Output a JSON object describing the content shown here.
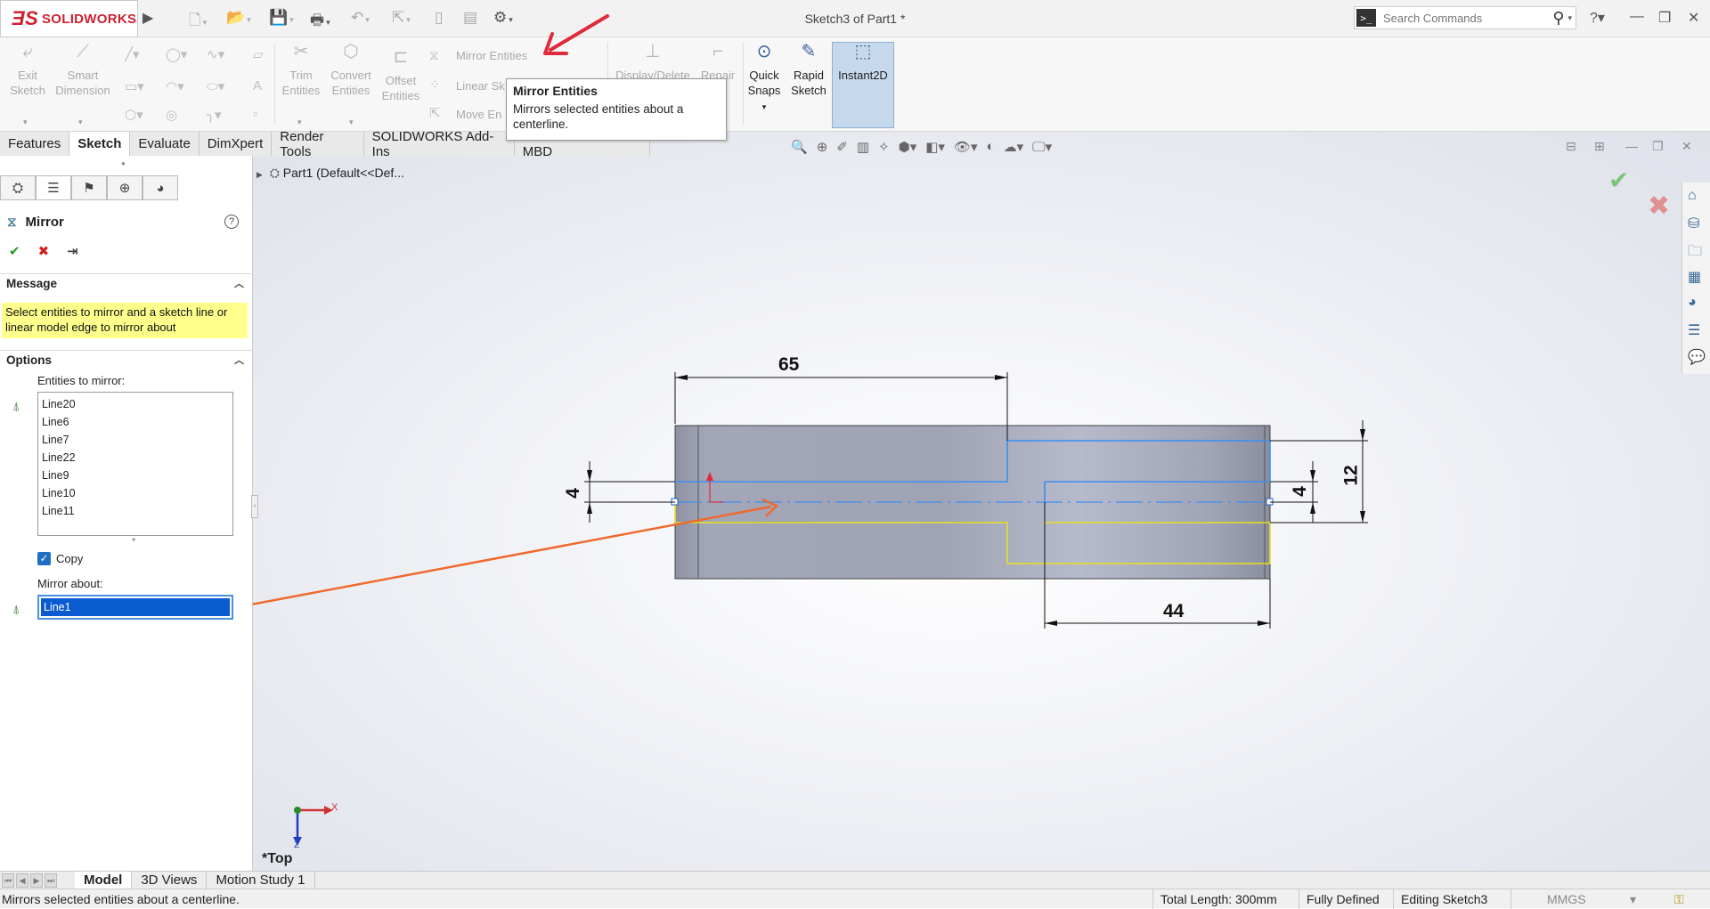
{
  "app": {
    "brand": "SOLIDWORKS",
    "window_title": "Sketch3 of Part1 *"
  },
  "search": {
    "placeholder": "Search Commands"
  },
  "commands": {
    "exit_sketch": "Exit Sketch",
    "smart_dimension": "Smart Dimension",
    "trim_entities": "Trim Entities",
    "convert_entities": "Convert Entities",
    "offset_entities": "Offset Entities",
    "mirror_entities": "Mirror Entities",
    "linear_sketch": "Linear Sk",
    "move_entities": "Move En",
    "display_delete": "Display/Delete",
    "repair": "Repair",
    "repair_2": "ch",
    "quick_snaps": "Quick Snaps",
    "rapid_sketch": "Rapid Sketch",
    "instant2d": "Instant2D"
  },
  "tooltip": {
    "title": "Mirror Entities",
    "description": "Mirrors selected entities about a centerline."
  },
  "tabs": [
    "Features",
    "Sketch",
    "Evaluate",
    "DimXpert",
    "Render Tools",
    "SOLIDWORKS Add-Ins",
    "SOLIDWORKS MBD"
  ],
  "selected_tab": "Sketch",
  "tree": {
    "root": "Part1  (Default<<Def..."
  },
  "pm": {
    "title": "Mirror",
    "message_header": "Message",
    "message": "Select entities to mirror and a sketch line or linear model edge to mirror about",
    "options_header": "Options",
    "entities_label": "Entities to mirror:",
    "entities": [
      "Line20",
      "Line6",
      "Line7",
      "Line22",
      "Line9",
      "Line10",
      "Line11"
    ],
    "copy_label": "Copy",
    "copy_checked": true,
    "mirror_about_label": "Mirror about:",
    "mirror_about_value": "Line1"
  },
  "dimensions": {
    "d65": "65",
    "d44": "44",
    "d4_left": "4",
    "d4_right": "4",
    "d12": "12"
  },
  "triad": {
    "x": "X",
    "z": "Z"
  },
  "view_name": "*Top",
  "bottom_tabs": [
    "Model",
    "3D Views",
    "Motion Study 1"
  ],
  "status": {
    "hint": "Mirrors selected entities about a centerline.",
    "total_length": "Total Length: 300mm",
    "defined": "Fully Defined",
    "editing": "Editing Sketch3",
    "units": "MMGS"
  },
  "colors": {
    "selection_blue": "#3d8ef0",
    "mirror_yellow": "#e8e020",
    "annotation_red": "#e02a3a",
    "annotation_orange": "#ee6a2e",
    "part_gray": "#9ea2b3"
  }
}
